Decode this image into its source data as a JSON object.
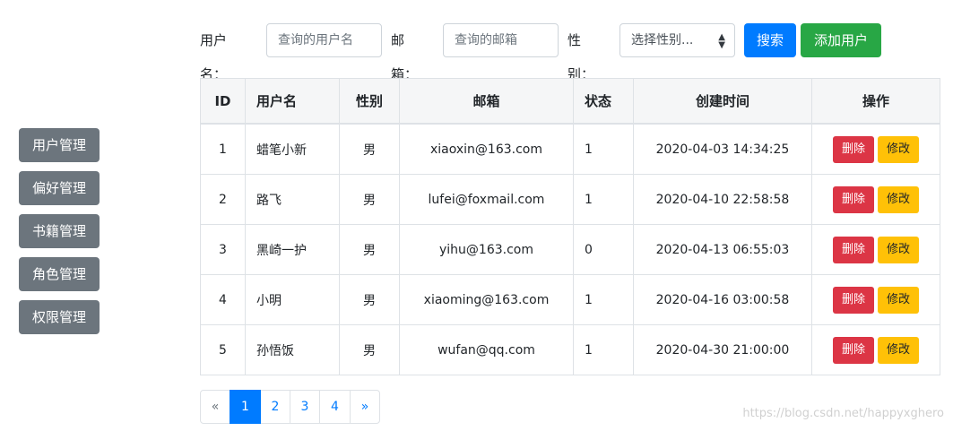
{
  "sidebar": {
    "items": [
      {
        "label": "用户管理"
      },
      {
        "label": "偏好管理"
      },
      {
        "label": "书籍管理"
      },
      {
        "label": "角色管理"
      },
      {
        "label": "权限管理"
      }
    ]
  },
  "search": {
    "username_label": "用户名：",
    "username_placeholder": "查询的用户名",
    "email_label": "邮箱：",
    "email_placeholder": "查询的邮箱",
    "gender_label": "性别：",
    "gender_selected": "选择性别...",
    "search_button": "搜索",
    "add_button": "添加用户"
  },
  "table": {
    "headers": [
      "ID",
      "用户名",
      "性别",
      "邮箱",
      "状态",
      "创建时间",
      "操作"
    ],
    "rows": [
      {
        "id": "1",
        "username": "蜡笔小新",
        "gender": "男",
        "email": "xiaoxin@163.com",
        "status": "1",
        "created": "2020-04-03 14:34:25"
      },
      {
        "id": "2",
        "username": "路飞",
        "gender": "男",
        "email": "lufei@foxmail.com",
        "status": "1",
        "created": "2020-04-10 22:58:58"
      },
      {
        "id": "3",
        "username": "黑崎一护",
        "gender": "男",
        "email": "yihu@163.com",
        "status": "0",
        "created": "2020-04-13 06:55:03"
      },
      {
        "id": "4",
        "username": "小明",
        "gender": "男",
        "email": "xiaoming@163.com",
        "status": "1",
        "created": "2020-04-16 03:00:58"
      },
      {
        "id": "5",
        "username": "孙悟饭",
        "gender": "男",
        "email": "wufan@qq.com",
        "status": "1",
        "created": "2020-04-30 21:00:00"
      }
    ],
    "delete_label": "删除",
    "edit_label": "修改"
  },
  "pagination": {
    "prev": "«",
    "pages": [
      "1",
      "2",
      "3",
      "4"
    ],
    "active_page": "1",
    "next": "»"
  },
  "watermark": "https://blog.csdn.net/happyxghero",
  "colors": {
    "primary": "#007bff",
    "success": "#28a745",
    "danger": "#dc3545",
    "warning": "#ffc107",
    "secondary": "#6c757d"
  }
}
